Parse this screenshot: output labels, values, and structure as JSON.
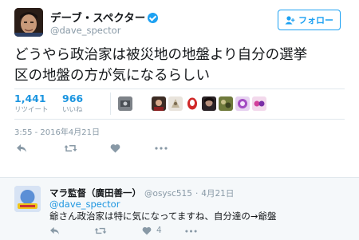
{
  "tweet": {
    "author_name": "デーブ・スペクター",
    "handle": "@dave_spector",
    "follow_label": "フォロー",
    "text_line1": "どうやら政治家は被災地の地盤より自分の選挙",
    "text_line2": "区の地盤の方が気になるらしい",
    "retweets": "1,441",
    "retweets_label": "リツイート",
    "likes": "966",
    "likes_label": "いいね",
    "timestamp": "3:55 - 2016年4月21日"
  },
  "icons": {
    "reply": "reply-icon",
    "retweet": "retweet-icon",
    "like": "heart-icon",
    "more": "more-icon",
    "follow": "person-add-icon",
    "verified": "verified-badge-icon"
  },
  "reply": {
    "author_name": "マラ監督（廣田善一）",
    "handle": "@osysc515",
    "separator": "·",
    "date": "4月21日",
    "mention": "@dave_spector",
    "text": "爺さん政治家は特に気になってますね、自分達の→爺盤",
    "likes": "4"
  },
  "colors": {
    "accent": "#1da1f2",
    "muted": "#8899a6",
    "reply_bg": "#f5f8fa"
  }
}
